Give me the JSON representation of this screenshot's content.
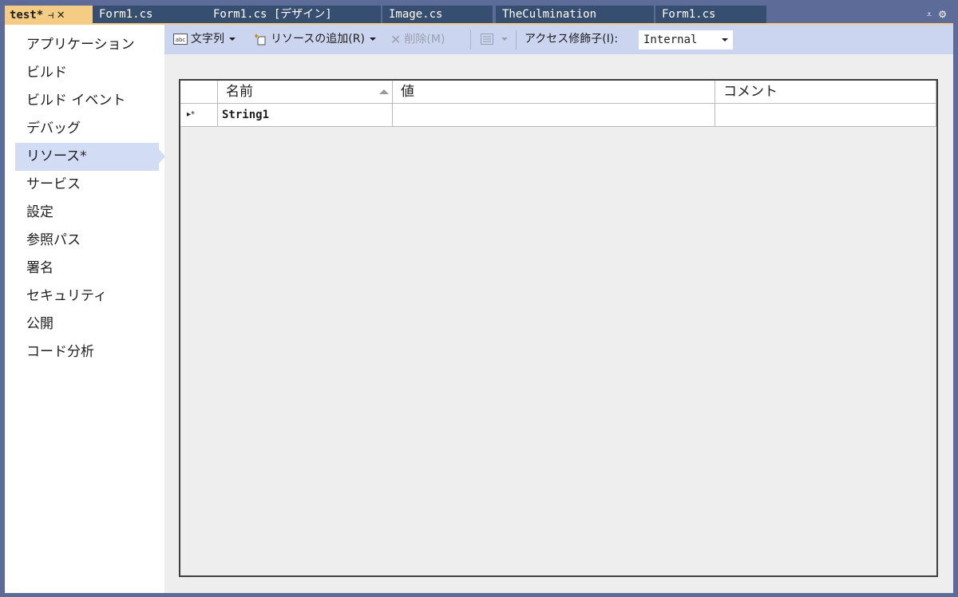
{
  "tabs": [
    {
      "label": "test*",
      "active": true
    },
    {
      "label": "Form1.cs"
    },
    {
      "label": "Form1.cs [デザイン]"
    },
    {
      "label": "Image.cs"
    },
    {
      "label": "TheCulmination"
    },
    {
      "label": "Form1.cs"
    }
  ],
  "tab_icons": {
    "pin": "pin-icon",
    "close": "close-icon",
    "overflow": "dropdown-overflow-icon",
    "settings": "gear-icon"
  },
  "sidebar": {
    "items": [
      {
        "label": "アプリケーション"
      },
      {
        "label": "ビルド"
      },
      {
        "label": "ビルド イベント"
      },
      {
        "label": "デバッグ"
      },
      {
        "label": "リソース*",
        "selected": true
      },
      {
        "label": "サービス"
      },
      {
        "label": "設定"
      },
      {
        "label": "参照パス"
      },
      {
        "label": "署名"
      },
      {
        "label": "セキュリティ"
      },
      {
        "label": "公開"
      },
      {
        "label": "コード分析"
      }
    ]
  },
  "toolbar": {
    "resource_type": "文字列",
    "add_resource": "リソースの追加(R)",
    "delete": "削除(M)",
    "access_modifier_label": "アクセス修飾子(I):",
    "access_modifier_value": "Internal"
  },
  "grid": {
    "columns": [
      "名前",
      "値",
      "コメント"
    ],
    "rows": [
      {
        "indicator": "▸*",
        "name": "String1",
        "value": "",
        "comment": ""
      }
    ]
  },
  "colors": {
    "frame": "#5d6b99",
    "active_tab": "#f5cc84",
    "inactive_tab": "#364e6f",
    "toolbar": "#ccd5f0",
    "selection": "#d3dcf5"
  }
}
